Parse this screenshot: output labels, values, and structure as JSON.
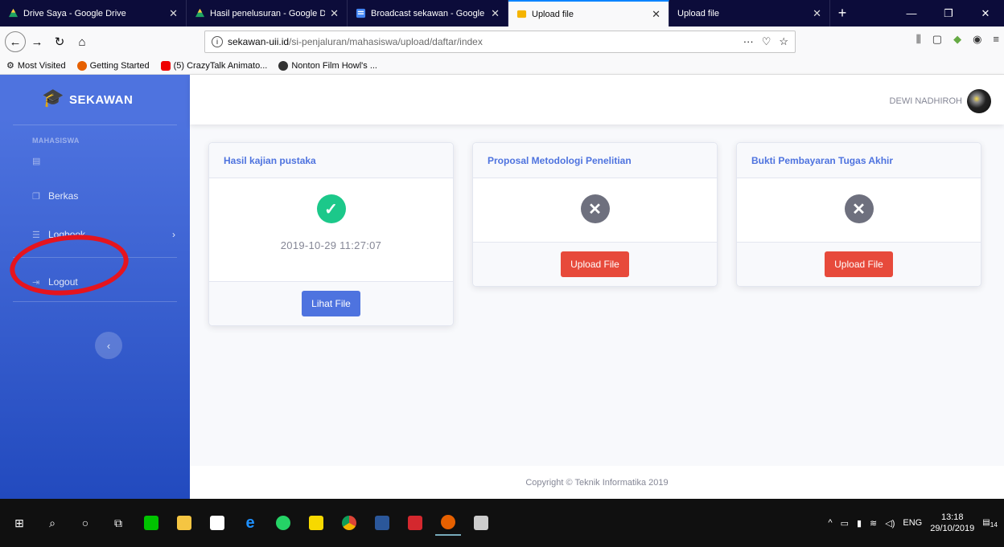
{
  "browser": {
    "tabs": [
      {
        "label": "Drive Saya - Google Drive",
        "icon": "google-drive-icon",
        "icon_color": "#1fa463"
      },
      {
        "label": "Hasil penelusuran - Google Dri",
        "icon": "google-drive-icon",
        "icon_color": "#1fa463"
      },
      {
        "label": "Broadcast sekawan - Google Do",
        "icon": "google-docs-icon",
        "icon_color": "#4285f4"
      },
      {
        "label": "Upload file",
        "icon": "sekawan-icon",
        "icon_color": "#f5b400",
        "active": true
      },
      {
        "label": "Upload file",
        "icon": "",
        "icon_color": ""
      }
    ],
    "url_host": "sekawan-uii.id",
    "url_path": "/si-penjaluran/mahasiswa/upload/daftar/index",
    "bookmarks": [
      {
        "label": "Most Visited",
        "icon": "gear-icon"
      },
      {
        "label": "Getting Started",
        "icon": "firefox-icon"
      },
      {
        "label": "(5) CrazyTalk Animato...",
        "icon": "youtube-icon"
      },
      {
        "label": "Nonton Film Howl's ...",
        "icon": "film-icon"
      }
    ]
  },
  "sidebar": {
    "brand": "SEKAWAN",
    "heading": "MAHASISWA",
    "items": [
      {
        "label": "",
        "icon": "upload-icon"
      },
      {
        "label": "Berkas",
        "icon": "copy-icon"
      },
      {
        "label": "Logbook",
        "icon": "list-icon",
        "chevron": "›"
      },
      {
        "label": "Logout",
        "icon": "sign-out-icon"
      }
    ],
    "toggle_glyph": "‹"
  },
  "topbar": {
    "user_name": "DEWI NADHIROH"
  },
  "cards": [
    {
      "title": "Hasil kajian pustaka",
      "status": "uploaded",
      "date": "2019-10-29 11:27:07",
      "button": "Lihat File"
    },
    {
      "title": "Proposal Metodologi Penelitian",
      "status": "missing",
      "date": "",
      "button": "Upload File"
    },
    {
      "title": "Bukti Pembayaran Tugas Akhir",
      "status": "missing",
      "date": "",
      "button": "Upload File"
    }
  ],
  "footer": {
    "copyright": "Copyright © Teknik Informatika 2019"
  },
  "taskbar": {
    "language": "ENG",
    "time": "13:18",
    "date": "29/10/2019",
    "notifications": "14"
  },
  "colors": {
    "primary": "#4e73df",
    "success": "#1cc88a",
    "danger": "#e74a3b",
    "secondary": "#6e707e",
    "highlight_circle": "#e5141e"
  }
}
